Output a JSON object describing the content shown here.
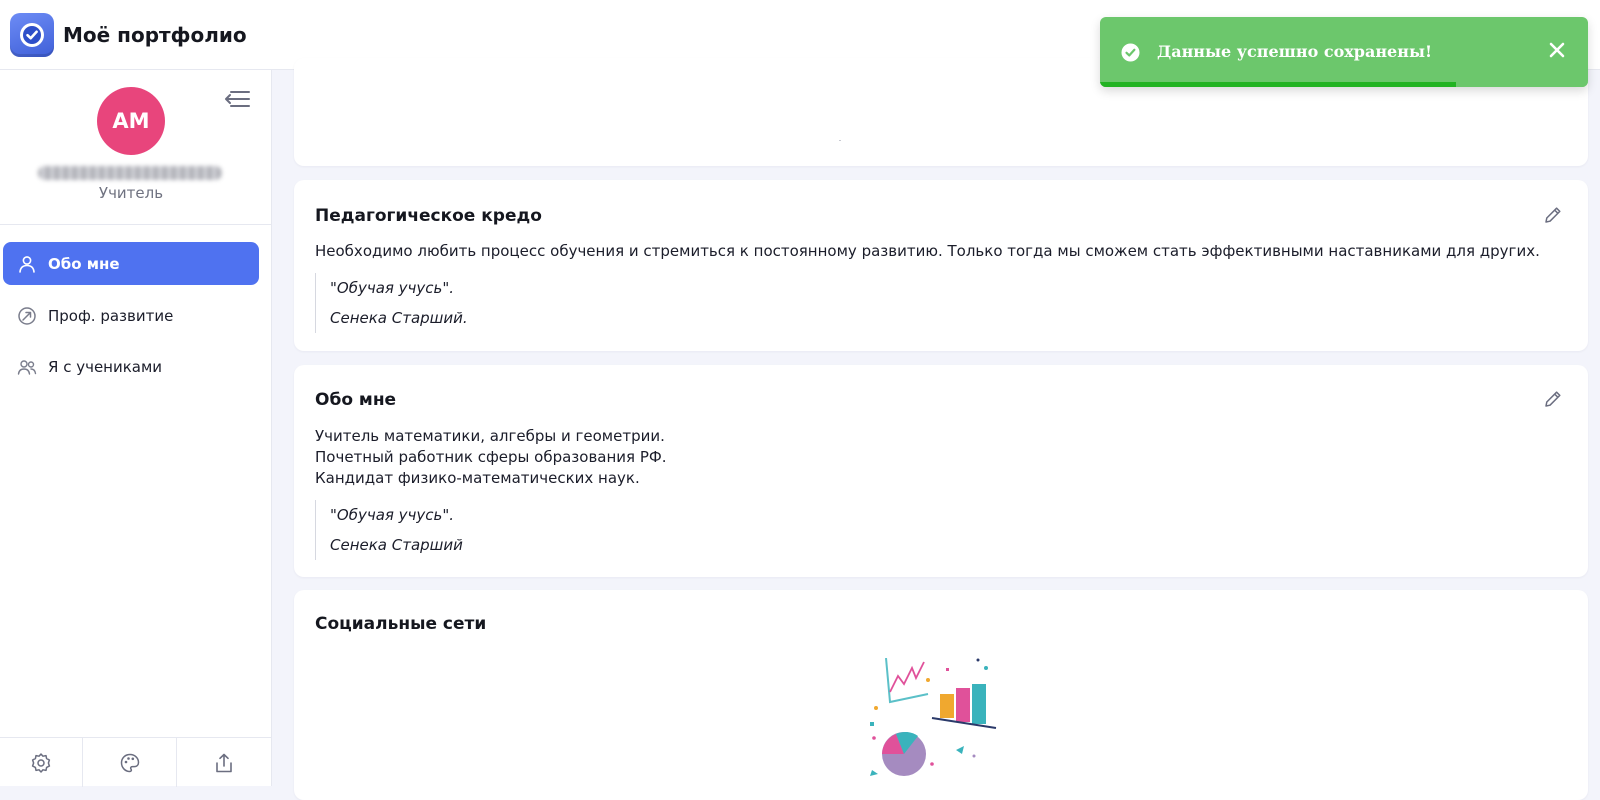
{
  "app": {
    "title": "Моё портфолио"
  },
  "sidebar": {
    "avatar_initials": "AM",
    "role": "Учитель",
    "nav": [
      {
        "label": "Обо мне",
        "icon": "user-icon",
        "active": true
      },
      {
        "label": "Проф. развитие",
        "icon": "growth-icon",
        "active": false
      },
      {
        "label": "Я с учениками",
        "icon": "users-icon",
        "active": false
      }
    ],
    "bottom_buttons": [
      "settings-icon",
      "palette-icon",
      "share-icon"
    ]
  },
  "cards": {
    "credo": {
      "title": "Педагогическое кредо",
      "text": "Необходимо любить процесс обучения и стремиться к постоянному развитию. Только тогда мы сможем стать эффективными наставниками для других.",
      "quote_text": "\"Обучая учусь\".",
      "quote_author": "Сенека Старший."
    },
    "about": {
      "title": "Обо мне",
      "lines": [
        "Учитель математики, алгебры и геометрии.",
        "Почетный работник сферы образования РФ.",
        "Кандидат физико-математических наук."
      ],
      "quote_text": "\"Обучая учусь\".",
      "quote_author": "Сенека Старший"
    },
    "social": {
      "title": "Социальные сети"
    }
  },
  "toast": {
    "message": "Данные успешно сохранены!",
    "progress": 0.73,
    "colors": {
      "background": "#6cc76c",
      "progress": "#22b322"
    }
  },
  "colors": {
    "accent": "#4f72f0",
    "avatar": "#e8457c"
  }
}
